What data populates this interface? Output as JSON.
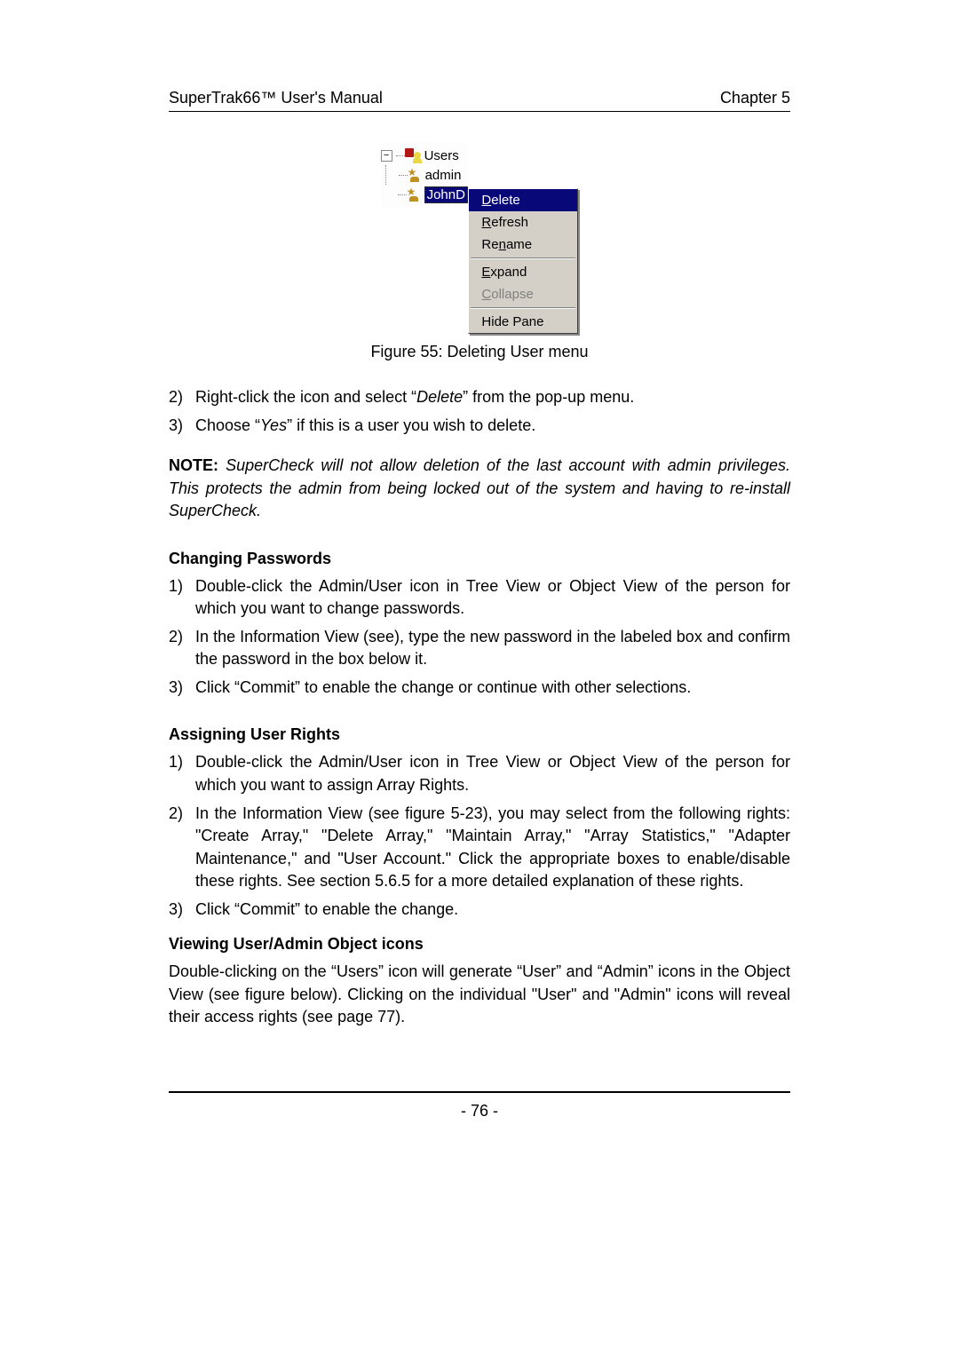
{
  "header": {
    "left": "SuperTrak66™ User's Manual",
    "right": "Chapter 5"
  },
  "tree": {
    "root": "Users",
    "children": [
      "admin",
      "JohnD"
    ],
    "selected": "JohnD"
  },
  "context_menu": {
    "items": [
      {
        "label": "Delete",
        "underline_idx": 0,
        "highlight": true,
        "disabled": false
      },
      {
        "label": "Refresh",
        "underline_idx": 0,
        "highlight": false,
        "disabled": false
      },
      {
        "label": "Rename",
        "underline_idx": 2,
        "highlight": false,
        "disabled": false
      }
    ],
    "items2": [
      {
        "label": "Expand",
        "underline_idx": 0,
        "highlight": false,
        "disabled": false
      },
      {
        "label": "Collapse",
        "underline_idx": 0,
        "highlight": false,
        "disabled": true
      }
    ],
    "items3": [
      {
        "label": "Hide Pane",
        "underline_idx": -1,
        "highlight": false,
        "disabled": false
      }
    ]
  },
  "figure_caption": "Figure 55: Deleting User menu",
  "intro_steps": [
    {
      "num": "2)",
      "text_pre": "Right-click the icon and select “",
      "italic": "Delete",
      "text_post": "” from the pop-up menu."
    },
    {
      "num": "3)",
      "text_pre": "Choose “",
      "italic": "Yes",
      "text_post": "” if this is a user you wish to delete."
    }
  ],
  "note": {
    "label": "NOTE: ",
    "text": "SuperCheck will not allow deletion of the last account with admin privileges. This protects the admin from being locked out of the system and having to re-install SuperCheck."
  },
  "section_passwords": {
    "heading": "Changing Passwords",
    "steps": [
      {
        "num": "1)",
        "text": "Double-click the Admin/User icon in Tree View or Object View of the person for which you want to change passwords."
      },
      {
        "num": "2)",
        "text": "In the Information View (see), type the new password in the labeled box and confirm the password in the box below it."
      },
      {
        "num": "3)",
        "text": "Click “Commit” to enable the change or continue with other selections."
      }
    ]
  },
  "section_rights": {
    "heading": "Assigning User Rights",
    "steps": [
      {
        "num": "1)",
        "text": "Double-click the Admin/User icon in Tree View or Object View of the person for which you want to assign Array Rights."
      },
      {
        "num": "2)",
        "text": "In the Information View (see figure 5-23), you may select from the following rights: \"Create Array,\" \"Delete Array,\" \"Maintain Array,\" \"Array Statistics,\" \"Adapter Maintenance,\" and \"User Account.\" Click the appropriate boxes to enable/disable these rights. See section 5.6.5 for a more detailed explanation of these rights."
      },
      {
        "num": "3)",
        "text": "Click “Commit” to enable the change."
      }
    ]
  },
  "section_viewing": {
    "heading": "Viewing User/Admin Object icons",
    "paragraph": "Double-clicking on the “Users” icon will generate “User” and “Admin” icons in the Object View (see figure below). Clicking on the individual \"User\" and \"Admin\" icons will reveal their access rights (see page 77)."
  },
  "page_number": "- 76 -"
}
